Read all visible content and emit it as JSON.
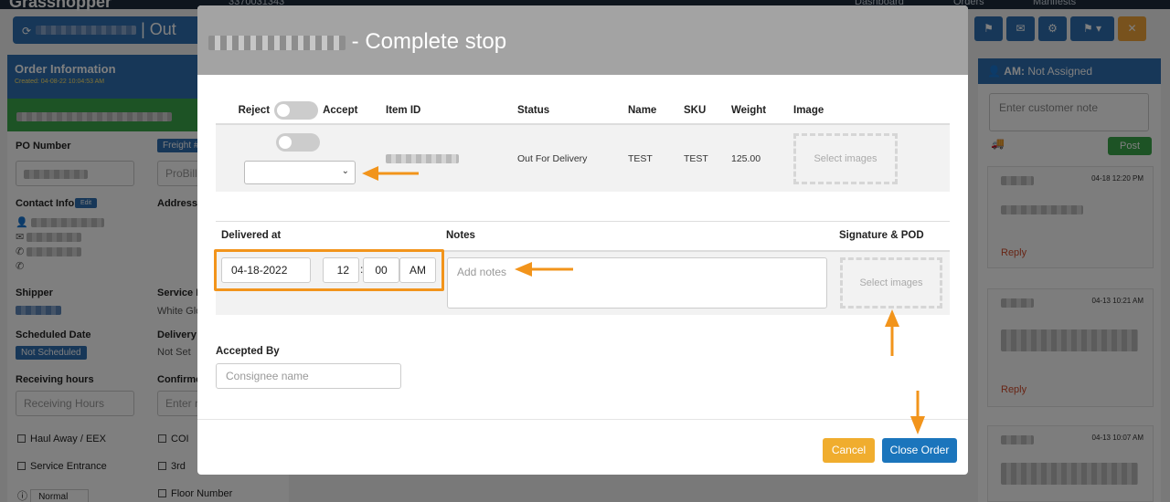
{
  "app": {
    "brand": "Grasshopper",
    "phone": "3370031343",
    "nav": [
      "Dashboard",
      "Orders",
      "Manifests"
    ],
    "title_prefix": "| Out"
  },
  "left_panel": {
    "title": "Order Information",
    "created": "Created: 04-08-22 10:04:53 AM",
    "po_label": "PO Number",
    "freight_badge": "Freight #",
    "probill_placeholder": "ProBill",
    "contact_label": "Contact Info",
    "edit_badge": "Edit",
    "address_label": "Address",
    "shipper_label": "Shipper",
    "service_label": "Service L",
    "service_value": "White Glo",
    "scheduled_label": "Scheduled Date",
    "not_scheduled": "Not Scheduled",
    "delivery_label": "Delivery",
    "delivery_value": "Not Set",
    "receiving_label": "Receiving hours",
    "receiving_placeholder": "Receiving Hours",
    "confirm_label": "Confirme",
    "enter_placeholder": "Enter r",
    "checks": [
      "Haul Away / EEX",
      "COI",
      "Service Entrance",
      "3rd",
      "Floor Number"
    ],
    "priority_value": "Normal"
  },
  "right_panel": {
    "am_label": "AM:",
    "am_value": "Not Assigned",
    "note_placeholder": "Enter customer note",
    "post_label": "Post",
    "cards": [
      {
        "time": "04-18 12:20 PM",
        "reply": "Reply"
      },
      {
        "time": "04-13 10:21 AM",
        "reply": "Reply"
      },
      {
        "time": "04-13 10:07 AM",
        "reply": ""
      }
    ]
  },
  "modal": {
    "title_suffix": "- Complete stop",
    "items_table": {
      "headers": {
        "reject": "Reject",
        "accept": "Accept",
        "item_id": "Item ID",
        "status": "Status",
        "name": "Name",
        "sku": "SKU",
        "weight": "Weight",
        "image": "Image"
      },
      "row": {
        "status": "Out For Delivery",
        "name": "TEST",
        "sku": "TEST",
        "weight": "125.00",
        "image_placeholder": "Select images"
      }
    },
    "delivery": {
      "headers": {
        "delivered_at": "Delivered at",
        "notes": "Notes",
        "signature": "Signature & POD"
      },
      "date": "04-18-2022",
      "hour": "12",
      "time_sep": ":",
      "minute": "00",
      "ampm": "AM",
      "notes_placeholder": "Add notes",
      "pod_placeholder": "Select images"
    },
    "accepted_by": {
      "label": "Accepted By",
      "placeholder": "Consignee name"
    },
    "buttons": {
      "cancel": "Cancel",
      "close": "Close Order"
    }
  },
  "colors": {
    "primary": "#1b75bc",
    "warning": "#f0ad2e",
    "annotation": "#f2941b",
    "success": "#3aa64a"
  }
}
